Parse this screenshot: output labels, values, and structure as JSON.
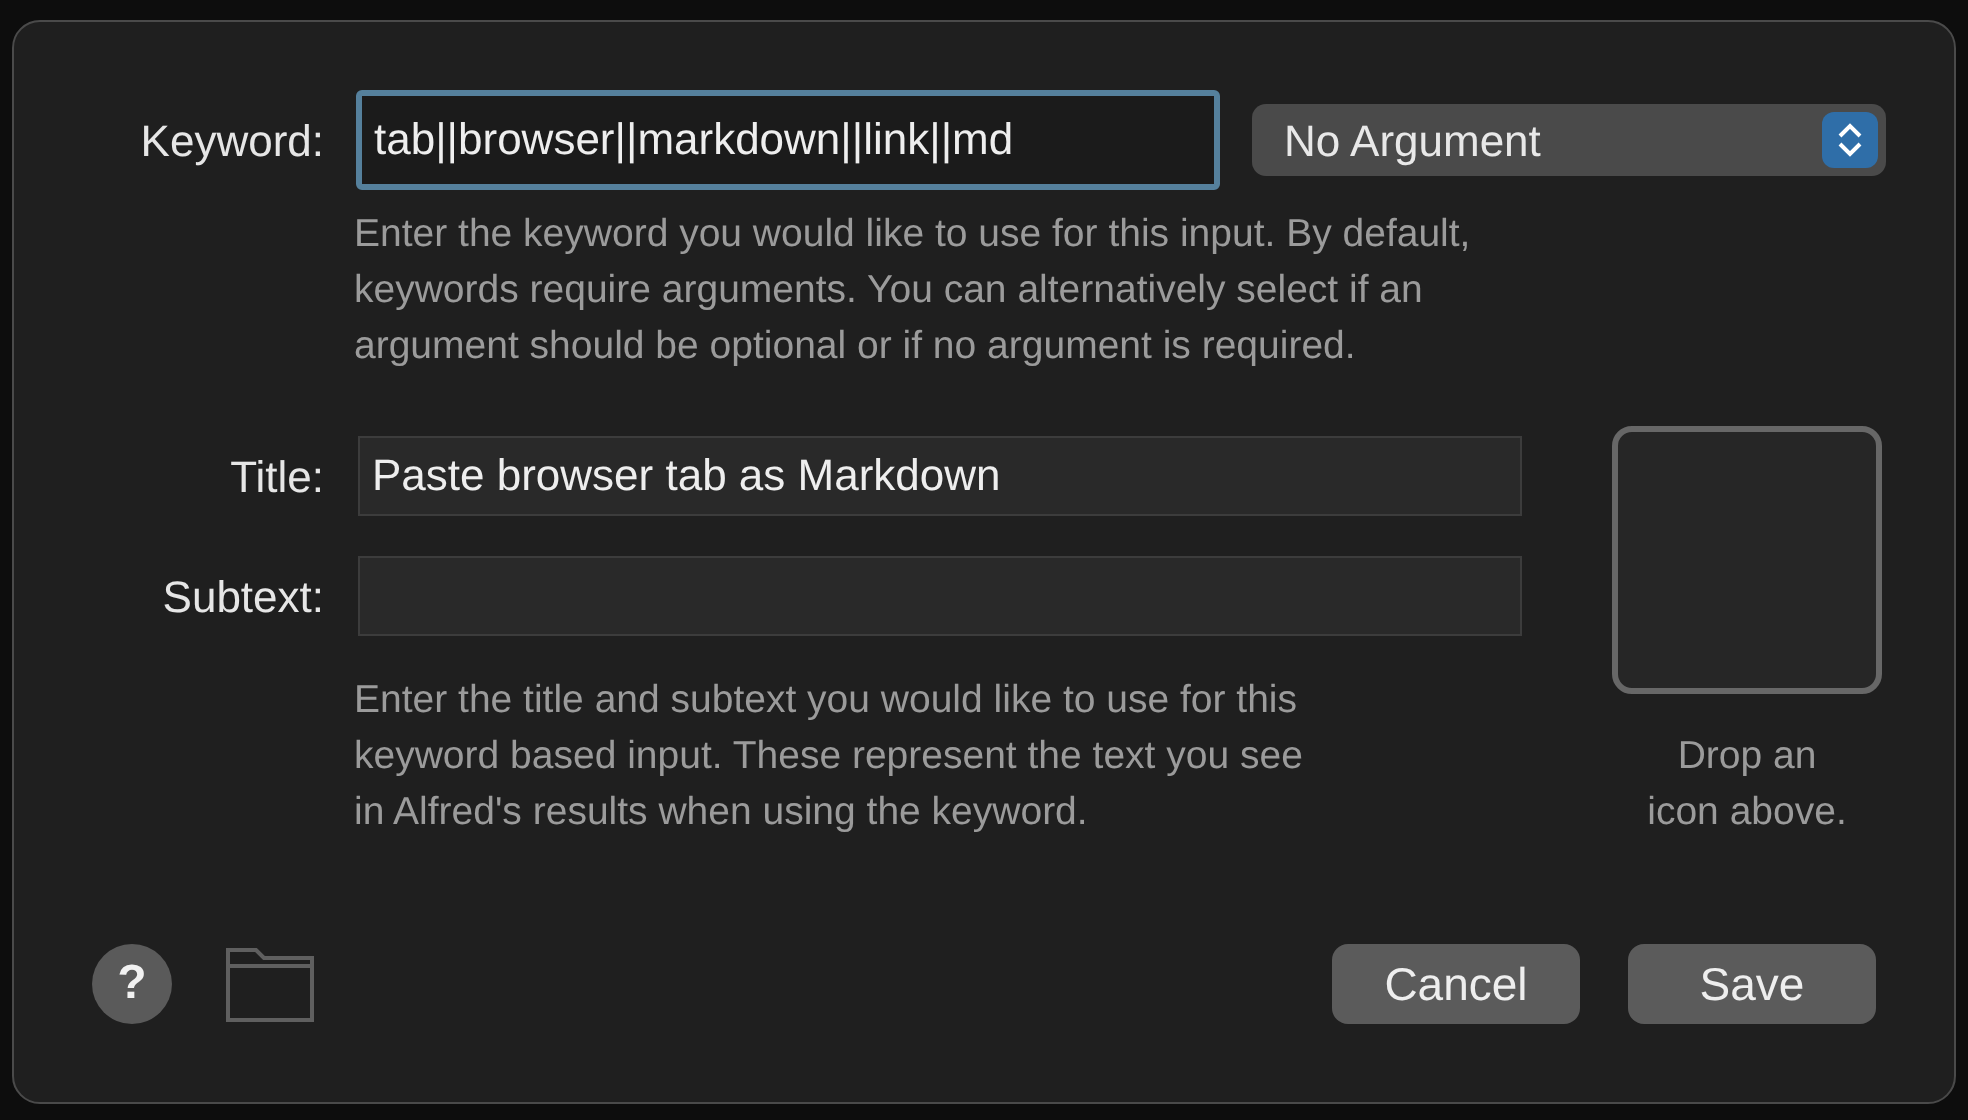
{
  "keyword": {
    "label": "Keyword:",
    "value": "tab||browser||markdown||link||md",
    "focused": true
  },
  "argument_select": {
    "value": "No Argument"
  },
  "keyword_help": "Enter the keyword you would like to use for this input. By default,\nkeywords require arguments. You can alternatively select if an\nargument should be optional or if no argument is required.",
  "title": {
    "label": "Title:",
    "value": "Paste browser tab as Markdown"
  },
  "subtext": {
    "label": "Subtext:"
  },
  "title_help": "Enter the title and subtext you would like to use for this\nkeyword based input. These represent the text you see\nin Alfred's results when using the keyword.",
  "icon_well": {
    "caption": "Drop an\nicon above."
  },
  "help_button": {
    "label": "?"
  },
  "buttons": [
    {
      "label": "Cancel"
    },
    {
      "label": "Save"
    }
  ]
}
